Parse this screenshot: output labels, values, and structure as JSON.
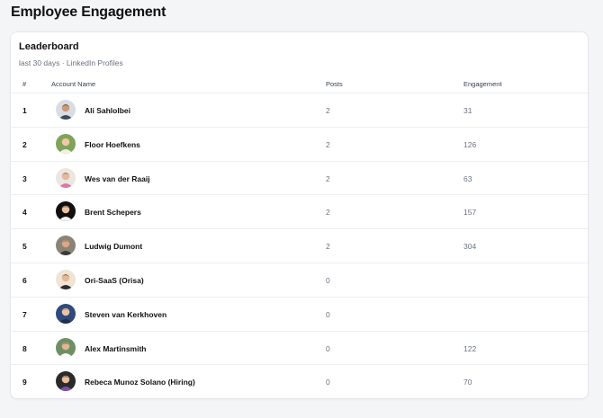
{
  "page": {
    "title": "Employee Engagement"
  },
  "leaderboard": {
    "title": "Leaderboard",
    "subtitle": "last 30 days · LinkedIn Profiles",
    "columns": {
      "rank": "#",
      "account": "Account Name",
      "posts": "Posts",
      "engagement": "Engagement"
    },
    "rows": [
      {
        "rank": "1",
        "name": "Ali Sahlolbei",
        "posts": "2",
        "engagement": "31",
        "avatar_bg": "#d9dde3",
        "avatar_skin": "#c99b7a",
        "avatar_hair": "#2b2220",
        "avatar_shirt": "#3b4a5c"
      },
      {
        "rank": "2",
        "name": "Floor Hoefkens",
        "posts": "2",
        "engagement": "126",
        "avatar_bg": "#7fa35a",
        "avatar_skin": "#f0c8a8",
        "avatar_hair": "#e8c873",
        "avatar_shirt": "#f2efe8"
      },
      {
        "rank": "3",
        "name": "Wes van der Raaij",
        "posts": "2",
        "engagement": "63",
        "avatar_bg": "#ece6e2",
        "avatar_skin": "#e6b89a",
        "avatar_hair": "#6b4a34",
        "avatar_shirt": "#d97aa0"
      },
      {
        "rank": "4",
        "name": "Brent Schepers",
        "posts": "2",
        "engagement": "157",
        "avatar_bg": "#101010",
        "avatar_skin": "#e9c2a2",
        "avatar_hair": "#2a1f18",
        "avatar_shirt": "#f5f5f5"
      },
      {
        "rank": "5",
        "name": "Ludwig Dumont",
        "posts": "2",
        "engagement": "304",
        "avatar_bg": "#8a8378",
        "avatar_skin": "#d8a888",
        "avatar_hair": "#5a4636",
        "avatar_shirt": "#3a3a3a"
      },
      {
        "rank": "6",
        "name": "Ori-SaaS (Orisa)",
        "posts": "0",
        "engagement": "",
        "avatar_bg": "#eee5d6",
        "avatar_skin": "#e3b998",
        "avatar_hair": "#3a2a1e",
        "avatar_shirt": "#2d2d2d"
      },
      {
        "rank": "7",
        "name": "Steven van Kerkhoven",
        "posts": "0",
        "engagement": "",
        "avatar_bg": "#2f4a7a",
        "avatar_skin": "#eac4a6",
        "avatar_hair": "#7a5a3a",
        "avatar_shirt": "#1f2f4d"
      },
      {
        "rank": "8",
        "name": "Alex Martinsmith",
        "posts": "0",
        "engagement": "122",
        "avatar_bg": "#6f8f63",
        "avatar_skin": "#e2b595",
        "avatar_hair": "#3a2c22",
        "avatar_shirt": "#ffffff"
      },
      {
        "rank": "9",
        "name": "Rebeca Munoz Solano (Hiring)",
        "posts": "0",
        "engagement": "70",
        "avatar_bg": "#2a2a2a",
        "avatar_skin": "#e7bf9f",
        "avatar_hair": "#1a1410",
        "avatar_shirt": "#7b4fb0"
      }
    ]
  }
}
